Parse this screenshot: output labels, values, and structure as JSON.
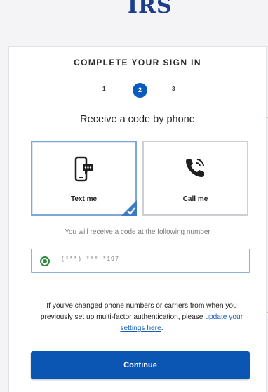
{
  "logo": {
    "text": "IRS"
  },
  "signin": {
    "heading": "COMPLETE YOUR SIGN IN",
    "steps": [
      "1",
      "2",
      "3"
    ],
    "current_step": 2,
    "subtitle": "Receive a code by phone"
  },
  "options": [
    {
      "label": "Text me",
      "icon": "smartphone-message-icon",
      "selected": true
    },
    {
      "label": "Call me",
      "icon": "phone-call-icon",
      "selected": false
    }
  ],
  "info_text": "You will receive a code at the following number",
  "phone": {
    "value": "(***) ***-*197",
    "selected": true
  },
  "help": {
    "text": "If you've changed phone numbers or carriers from when you previously set up multi-factor authentication, please",
    "link_text": "update your settings here",
    "trailing": "."
  },
  "continue_label": "Continue",
  "colors": {
    "primary": "#0b55b3",
    "step_active": "#0a5bc0",
    "radio": "#2e8b3a",
    "arrow": "#e8742a"
  }
}
